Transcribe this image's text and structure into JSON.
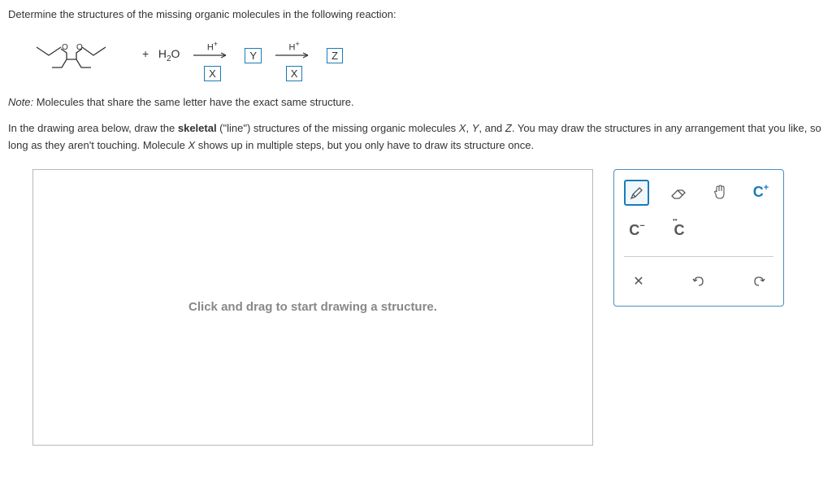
{
  "question": "Determine the structures of the missing organic molecules in the following reaction:",
  "reagent": "+   H₂O",
  "arrow_label": "H⁺",
  "letters": {
    "X": "X",
    "Y": "Y",
    "Z": "Z"
  },
  "note_prefix": "Note:",
  "note_body": " Molecules that share the same letter have the exact same structure.",
  "instruction_1": "In the drawing area below, draw the ",
  "instruction_bold": "skeletal",
  "instruction_2": " (\"line\") structures of the missing organic molecules ",
  "mol_x": "X",
  "comma1": ", ",
  "mol_y": "Y",
  "comma2": ", and ",
  "mol_z": "Z",
  "instruction_3": ". You may draw the structures in any arrangement that you like, so long as they aren't touching. Molecule ",
  "instruction_4": " shows up in multiple steps, but you only have to draw its structure once.",
  "canvas_placeholder": "Click and drag to start drawing a structure.",
  "tools": {
    "pencil": "✎",
    "eraser": "✐",
    "hand": "✋",
    "c_plus": "C",
    "c_plus_sup": "+",
    "c_minus": "C",
    "c_minus_sup": "−",
    "c_dots": "C",
    "close": "✕",
    "undo": "↶",
    "redo": "↷"
  }
}
